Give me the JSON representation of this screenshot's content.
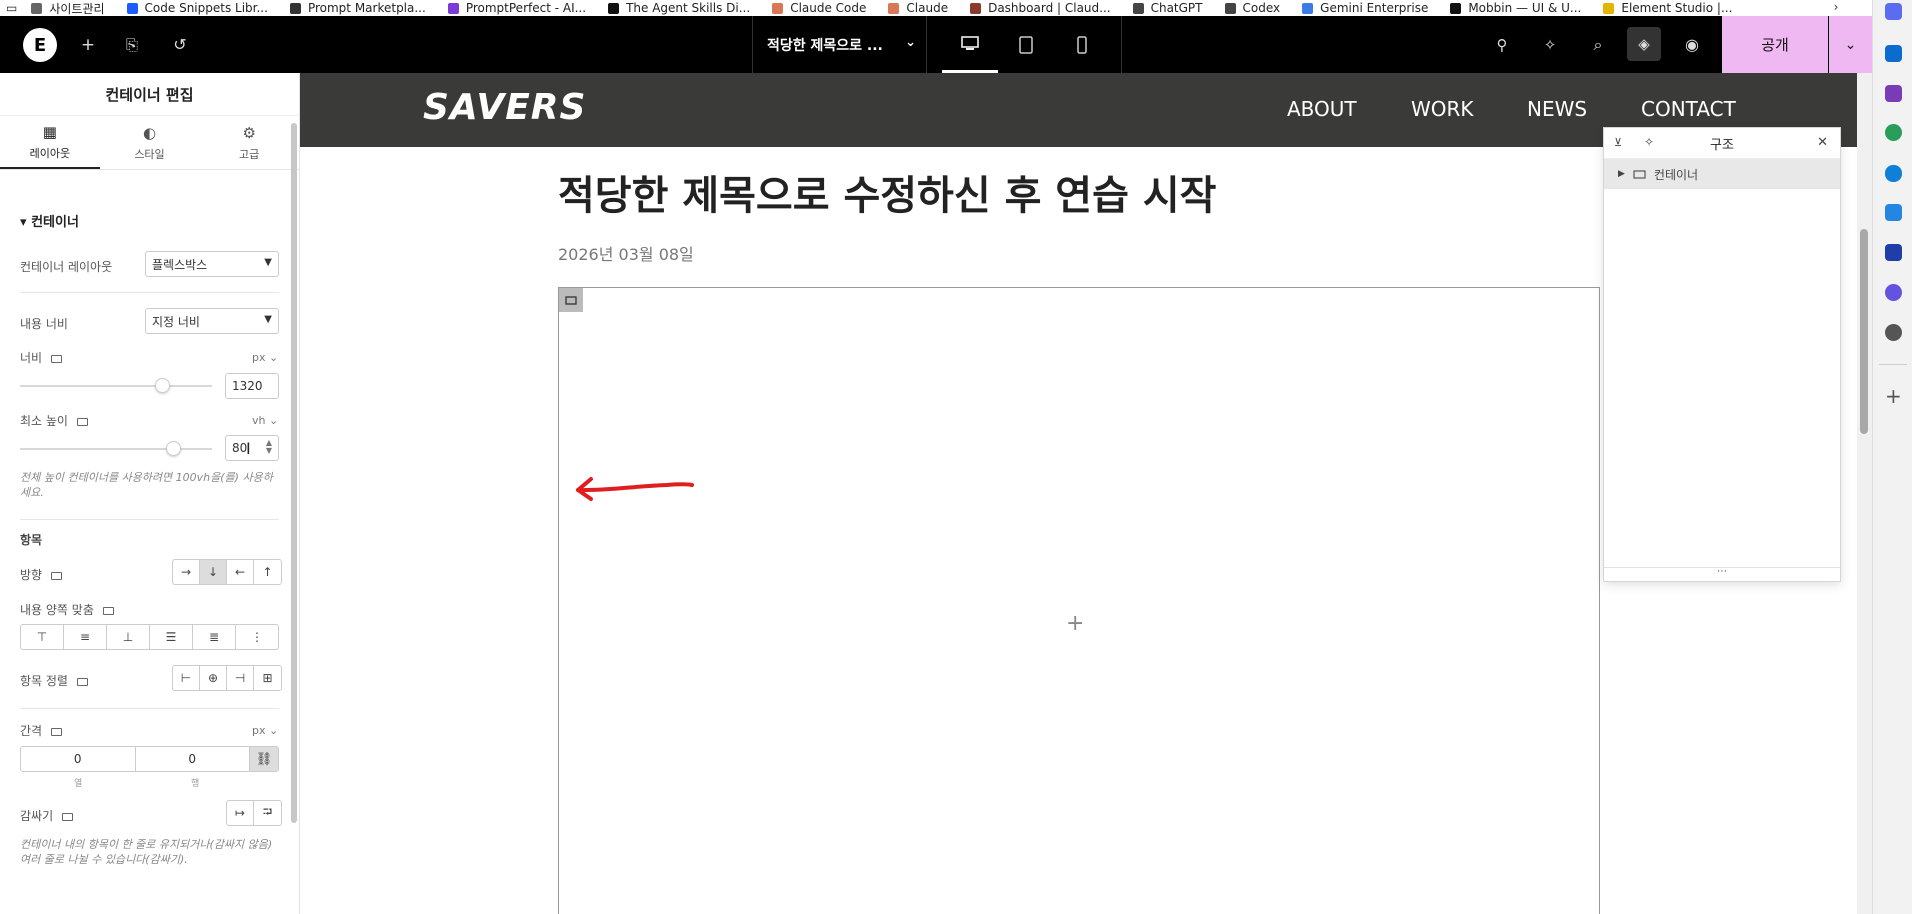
{
  "bookmarks": [
    "사이트관리",
    "Code Snippets Libr...",
    "Prompt Marketpla...",
    "PromptPerfect - AI...",
    "The Agent Skills Di...",
    "Claude Code",
    "Claude",
    "Dashboard | Claud...",
    "ChatGPT",
    "Codex",
    "Gemini Enterprise",
    "Mobbin — UI & U...",
    "Element Studio |..."
  ],
  "bookmark_colors": [
    "#666666",
    "#1a5cff",
    "#333333",
    "#7a3bd8",
    "#111111",
    "#d97757",
    "#d97757",
    "#8b3b2b",
    "#444444",
    "#444444",
    "#3c7be8",
    "#111111",
    "#e4b400"
  ],
  "topbar": {
    "logo": "E",
    "page_title": "적당한 제목으로 ...",
    "publish": "공개"
  },
  "panel": {
    "title": "컨테이너 편집",
    "tabs": [
      {
        "icon": "▦",
        "label": "레이아웃"
      },
      {
        "icon": "◐",
        "label": "스타일"
      },
      {
        "icon": "⚙",
        "label": "고급"
      }
    ],
    "section": "컨테이너",
    "container_layout_label": "컨테이너 레이아웃",
    "container_layout_value": "플렉스박스",
    "content_width_label": "내용 너비",
    "content_width_value": "지정 너비",
    "width_label": "너비",
    "width_unit": "px",
    "width_value": "1320",
    "min_height_label": "최소 높이",
    "min_height_unit": "vh",
    "min_height_value": "80",
    "min_height_hint": "전체 높이 컨테이너를 사용하려면 100vh을(를) 사용하세요.",
    "items_heading": "항목",
    "direction_label": "방향",
    "direction_buttons": [
      "→",
      "↓",
      "←",
      "↑"
    ],
    "justify_label": "내용 양쪽 맞춤",
    "justify_buttons": [
      "⊤",
      "≡",
      "⊥",
      "☰",
      "≣",
      "⋮"
    ],
    "align_label": "항목 정렬",
    "align_buttons": [
      "⊢",
      "⊕",
      "⊣",
      "⊞"
    ],
    "gap_label": "간격",
    "gap_unit": "px",
    "gap_col": "0",
    "gap_row": "0",
    "gap_col_label": "열",
    "gap_row_label": "행",
    "wrap_label": "감싸기",
    "wrap_buttons": [
      "↦",
      "⮒"
    ],
    "wrap_hint": "컨테이너 내의 항목이 한 줄로 유지되거나(감싸지 않음) 여러 줄로 나뉠 수 있습니다(감싸기)."
  },
  "canvas": {
    "brand": "SAVERS",
    "nav": [
      "ABOUT",
      "WORK",
      "NEWS",
      "CONTACT"
    ],
    "post_title": "적당한 제목으로 수정하신 후 연습 시작",
    "post_date": "2026년 03월 08일"
  },
  "structure": {
    "title": "구조",
    "item": "컨테이너"
  },
  "accent_color": "#f0b8f3",
  "annotation_color": "#e11d1d"
}
